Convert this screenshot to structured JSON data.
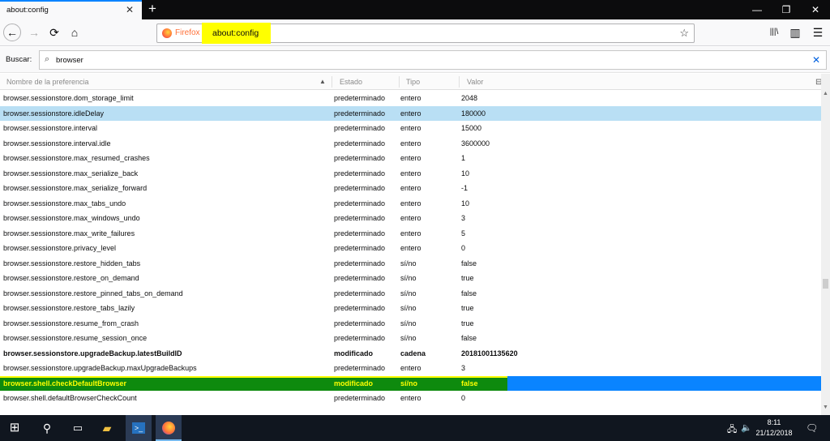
{
  "tab": {
    "title": "about:config",
    "close": "✕"
  },
  "window": {
    "minimize": "—",
    "maximize": "❐",
    "close": "✕"
  },
  "nav": {
    "back": "←",
    "forward": "→",
    "reload": "⟳",
    "home": "⌂",
    "identity_label": "Firefox",
    "url": "about:config",
    "bookmark": "☆",
    "library": "|||\\",
    "sidebar": "▥",
    "menu": "☰"
  },
  "search": {
    "label": "Buscar:",
    "value": "browser",
    "icon": "⌕",
    "clear": "✕"
  },
  "columns": {
    "name": "Nombre de la preferencia",
    "state": "Estado",
    "type": "Tipo",
    "value": "Valor"
  },
  "rows": [
    {
      "name": "browser.sessionstore.dom_storage_limit",
      "state": "predeterminado",
      "type": "entero",
      "value": "2048"
    },
    {
      "name": "browser.sessionstore.idleDelay",
      "state": "predeterminado",
      "type": "entero",
      "value": "180000"
    },
    {
      "name": "browser.sessionstore.interval",
      "state": "predeterminado",
      "type": "entero",
      "value": "15000"
    },
    {
      "name": "browser.sessionstore.interval.idle",
      "state": "predeterminado",
      "type": "entero",
      "value": "3600000"
    },
    {
      "name": "browser.sessionstore.max_resumed_crashes",
      "state": "predeterminado",
      "type": "entero",
      "value": "1"
    },
    {
      "name": "browser.sessionstore.max_serialize_back",
      "state": "predeterminado",
      "type": "entero",
      "value": "10"
    },
    {
      "name": "browser.sessionstore.max_serialize_forward",
      "state": "predeterminado",
      "type": "entero",
      "value": "-1"
    },
    {
      "name": "browser.sessionstore.max_tabs_undo",
      "state": "predeterminado",
      "type": "entero",
      "value": "10"
    },
    {
      "name": "browser.sessionstore.max_windows_undo",
      "state": "predeterminado",
      "type": "entero",
      "value": "3"
    },
    {
      "name": "browser.sessionstore.max_write_failures",
      "state": "predeterminado",
      "type": "entero",
      "value": "5"
    },
    {
      "name": "browser.sessionstore.privacy_level",
      "state": "predeterminado",
      "type": "entero",
      "value": "0"
    },
    {
      "name": "browser.sessionstore.restore_hidden_tabs",
      "state": "predeterminado",
      "type": "sí/no",
      "value": "false"
    },
    {
      "name": "browser.sessionstore.restore_on_demand",
      "state": "predeterminado",
      "type": "sí/no",
      "value": "true"
    },
    {
      "name": "browser.sessionstore.restore_pinned_tabs_on_demand",
      "state": "predeterminado",
      "type": "sí/no",
      "value": "false"
    },
    {
      "name": "browser.sessionstore.restore_tabs_lazily",
      "state": "predeterminado",
      "type": "sí/no",
      "value": "true"
    },
    {
      "name": "browser.sessionstore.resume_from_crash",
      "state": "predeterminado",
      "type": "sí/no",
      "value": "true"
    },
    {
      "name": "browser.sessionstore.resume_session_once",
      "state": "predeterminado",
      "type": "sí/no",
      "value": "false"
    },
    {
      "name": "browser.sessionstore.upgradeBackup.latestBuildID",
      "state": "modificado",
      "type": "cadena",
      "value": "20181001135620"
    },
    {
      "name": "browser.sessionstore.upgradeBackup.maxUpgradeBackups",
      "state": "predeterminado",
      "type": "entero",
      "value": "3"
    },
    {
      "name": "browser.shell.checkDefaultBrowser",
      "state": "modificado",
      "type": "sí/no",
      "value": "false"
    },
    {
      "name": "browser.shell.defaultBrowserCheckCount",
      "state": "predeterminado",
      "type": "entero",
      "value": "0"
    }
  ],
  "taskbar": {
    "time": "8:11",
    "date": "21/12/2018",
    "powershell_label": ">_"
  },
  "colors": {
    "accent": "#0a84ff",
    "highlight_yellow": "#ffff00",
    "highlight_green": "#0e8a0e",
    "selected_row": "#b9dff4"
  }
}
